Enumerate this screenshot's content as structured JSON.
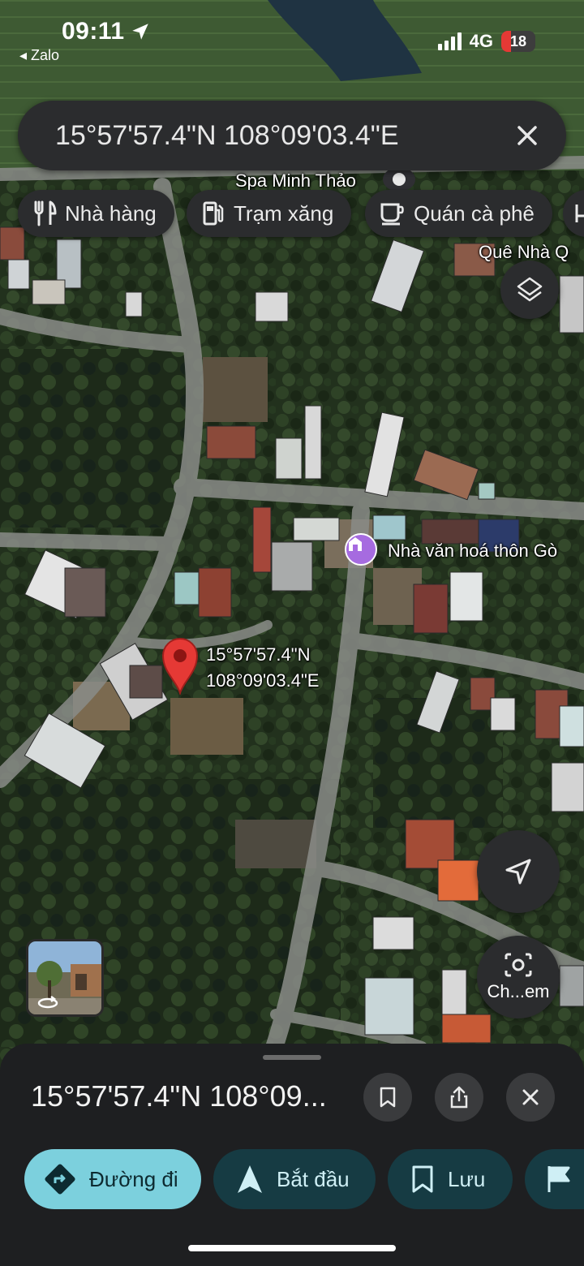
{
  "status_bar": {
    "time": "09:11",
    "back_app": "◂ Zalo",
    "network": "4G",
    "battery": "18",
    "icons": [
      "location-arrow-icon",
      "signal-icon",
      "battery-icon"
    ]
  },
  "search": {
    "text": "15°57'57.4\"N 108°09'03.4\"E",
    "close_icon": "close-icon"
  },
  "chips": [
    {
      "label": "Nhà hàng",
      "icon": "restaurant-icon"
    },
    {
      "label": "Trạm xăng",
      "icon": "gas-station-icon"
    },
    {
      "label": "Quán cà phê",
      "icon": "coffee-icon"
    }
  ],
  "map": {
    "labels": {
      "spa": "Spa Minh Thảo",
      "que_nha": "Quê Nhà Q",
      "cultural_house": "Nhà văn hoá thôn Gò"
    },
    "pin": {
      "lat": "15°57'57.4\"N",
      "lng": "108°09'03.4\"E"
    },
    "controls": {
      "layers_icon": "layers-icon",
      "locate_icon": "navigation-arrow-icon",
      "lens_label": "Ch...em",
      "lens_icon": "camera-search-icon",
      "streetview_icon": "street-view-rotate-icon"
    }
  },
  "sheet": {
    "title": "15°57'57.4\"N 108°09...",
    "icons": [
      "bookmark-icon",
      "share-icon",
      "close-icon"
    ],
    "actions": [
      {
        "label": "Đường đi",
        "icon": "directions-icon"
      },
      {
        "label": "Bắt đầu",
        "icon": "navigation-start-icon"
      },
      {
        "label": "Lưu",
        "icon": "bookmark-icon"
      },
      {
        "label": "",
        "icon": "flag-icon"
      }
    ]
  },
  "colors": {
    "primary_action": "#7cd0dd",
    "secondary_action": "#163b43",
    "pin": "#e53935",
    "poi_purple": "#a66be0"
  }
}
